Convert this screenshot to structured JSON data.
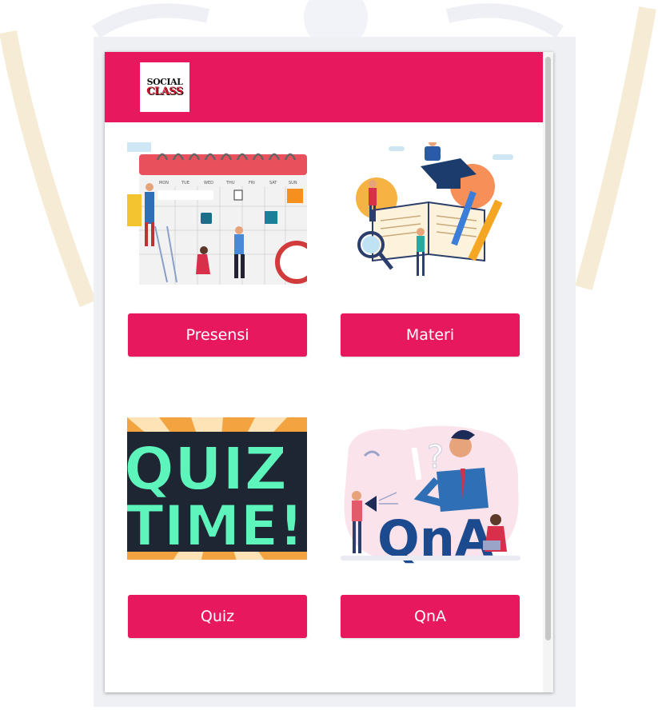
{
  "app": {
    "logo": {
      "line1": "SOCIAL",
      "line2": "CLASS"
    }
  },
  "menu": [
    {
      "label": "Presensi",
      "image": "calendar-illustration"
    },
    {
      "label": "Materi",
      "image": "learning-books-illustration"
    },
    {
      "label": "Quiz",
      "image": "quiz-time-illustration",
      "image_text": [
        "QUIZ",
        "TIME!"
      ]
    },
    {
      "label": "QnA",
      "image": "qna-illustration",
      "image_text": "QnA"
    }
  ],
  "calendar": {
    "days": [
      "MON",
      "TUE",
      "WED",
      "THU",
      "FRI",
      "SAT",
      "SUN"
    ]
  },
  "colors": {
    "brand": "#e8185e",
    "frame": "#eef0f3",
    "background": "#ffffff"
  }
}
